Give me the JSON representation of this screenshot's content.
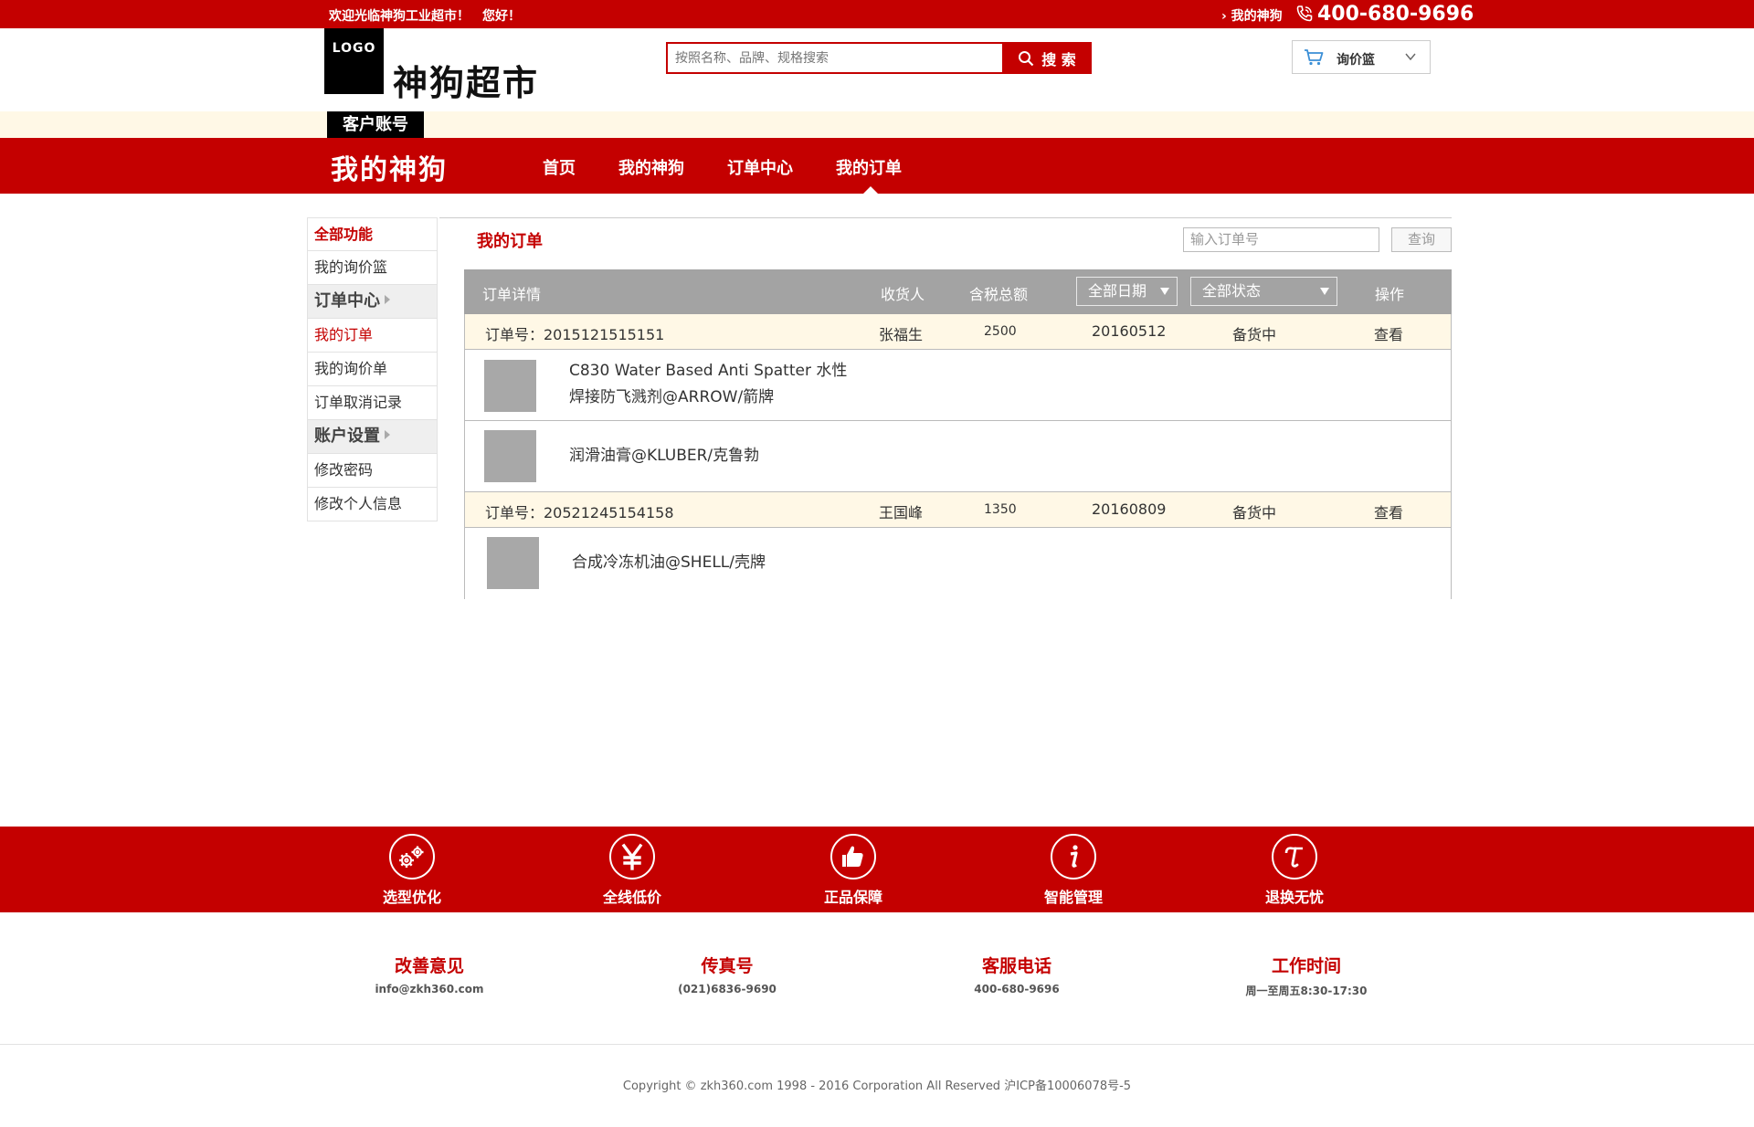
{
  "topbar": {
    "welcome": "欢迎光临神狗工业超市！　您好！",
    "my_link": "› 我的神狗",
    "phone": "400-680-9696"
  },
  "header": {
    "logo": "LOGO",
    "site_name": "神狗超市",
    "search_placeholder": "按照名称、品牌、规格搜索",
    "search_button": "搜 索",
    "cart_label": "询价篮"
  },
  "account_tab": "客户账号",
  "nav": {
    "brand": "我的神狗",
    "items": [
      "首页",
      "我的神狗",
      "订单中心",
      "我的订单"
    ]
  },
  "sidebar": {
    "items": [
      {
        "label": "全部功能"
      },
      {
        "label": "我的询价篮"
      },
      {
        "label": "订单中心"
      },
      {
        "label": "我的订单"
      },
      {
        "label": "我的询价单"
      },
      {
        "label": "订单取消记录"
      },
      {
        "label": "账户设置"
      },
      {
        "label": "修改密码"
      },
      {
        "label": "修改个人信息"
      }
    ]
  },
  "main": {
    "title": "我的订单",
    "order_search_placeholder": "输入订单号",
    "query_button": "查询",
    "columns": {
      "detail": "订单详情",
      "receiver": "收货人",
      "amount": "含税总额",
      "date_filter": "全部日期",
      "status_filter": "全部状态",
      "action": "操作"
    },
    "orders": [
      {
        "number_label": "订单号：2015121515151",
        "receiver": "张福生",
        "amount": "2500",
        "date": "20160512",
        "status": "备货中",
        "action": "查看",
        "products": [
          {
            "name_line1": "C830 Water Based Anti Spatter 水性",
            "name_line2": "焊接防飞溅剂@ARROW/箭牌"
          },
          {
            "name_line1": "润滑油膏@KLUBER/克鲁勃"
          }
        ]
      },
      {
        "number_label": "订单号：20521245154158",
        "receiver": "王国峰",
        "amount": "1350",
        "date": "20160809",
        "status": "备货中",
        "action": "查看",
        "products": [
          {
            "name_line1": "合成冷冻机油@SHELL/壳牌"
          }
        ]
      }
    ]
  },
  "features": [
    {
      "label": "选型优化",
      "icon": "gears-icon"
    },
    {
      "label": "全线低价",
      "icon": "yen-icon"
    },
    {
      "label": "正品保障",
      "icon": "thumbs-up-icon"
    },
    {
      "label": "智能管理",
      "icon": "info-icon"
    },
    {
      "label": "退换无忧",
      "icon": "return-icon"
    }
  ],
  "contact": [
    {
      "title": "改善意见",
      "value": "info@zkh360.com"
    },
    {
      "title": "传真号",
      "value": "(021)6836-9690"
    },
    {
      "title": "客服电话",
      "value": "400-680-9696"
    },
    {
      "title": "工作时间",
      "value": "周一至周五8:30-17:30"
    }
  ],
  "copyright": "Copyright © zkh360.com 1998 - 2016 Corporation All Reserved 沪ICP备10006078号-5",
  "colors": {
    "brand_red": "#c40000",
    "cream": "#fff8e6",
    "table_header_gray": "#a3a3a3"
  }
}
